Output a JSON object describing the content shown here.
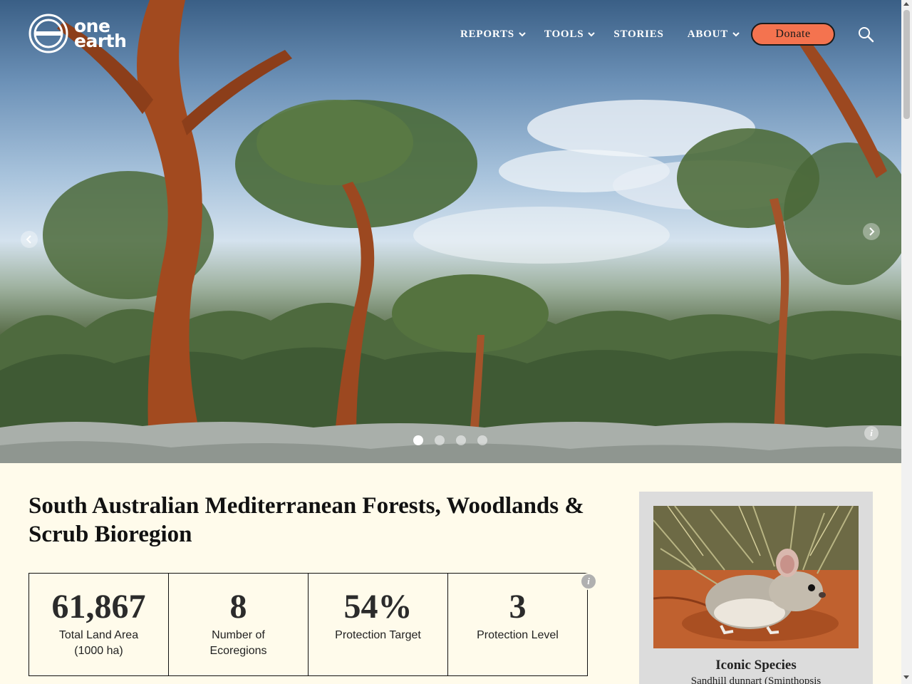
{
  "brand": {
    "logo_line1": "one",
    "logo_line2": "earth"
  },
  "nav": {
    "items": [
      {
        "label": "REPORTS",
        "has_dropdown": true
      },
      {
        "label": "TOOLS",
        "has_dropdown": true
      },
      {
        "label": "STORIES",
        "has_dropdown": false
      },
      {
        "label": "ABOUT",
        "has_dropdown": true
      }
    ],
    "donate_label": "Donate",
    "search_icon": "search-icon"
  },
  "hero": {
    "slide_count": 4,
    "active_slide": 1,
    "info_glyph": "i"
  },
  "page": {
    "title": "South Australian Mediterranean Forests, Woodlands & Scrub Bioregion"
  },
  "stats": [
    {
      "value": "61,867",
      "label": "Total Land Area (1000 ha)"
    },
    {
      "value": "8",
      "label": "Number of Ecoregions"
    },
    {
      "value": "54%",
      "label": "Protection Target"
    },
    {
      "value": "3",
      "label": "Protection Level"
    }
  ],
  "stats_info_glyph": "i",
  "species": {
    "heading": "Iconic Species",
    "name": "Sandhill dunnart (Sminthopsis"
  },
  "colors": {
    "background": "#fffbeb",
    "donate": "#f4734f",
    "card": "#dcdcdc"
  }
}
